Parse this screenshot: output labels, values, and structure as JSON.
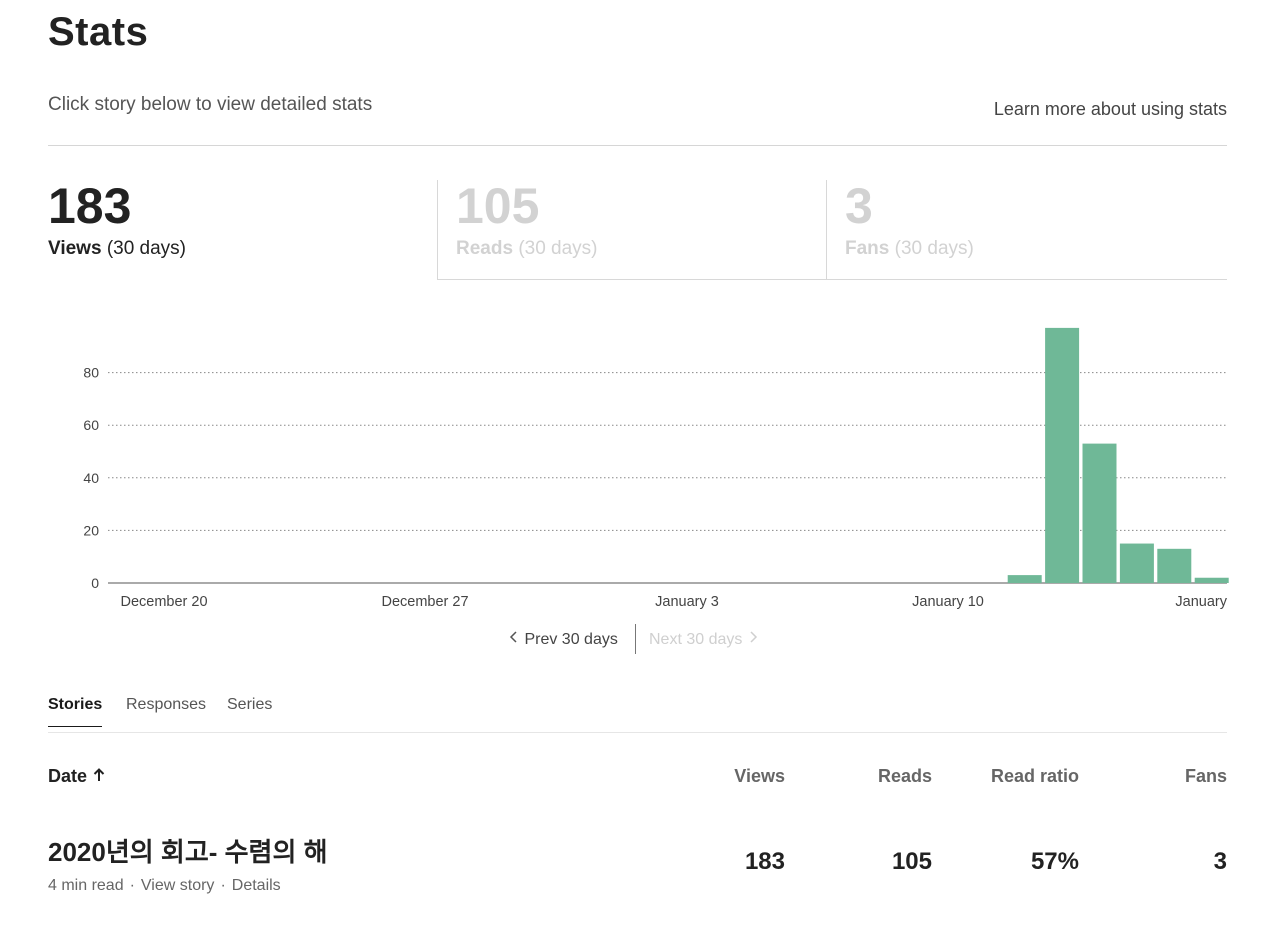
{
  "header": {
    "title": "Stats",
    "subtitle": "Click story below to view detailed stats",
    "learn_more": "Learn more about using stats"
  },
  "metrics": [
    {
      "value": "183",
      "label": "Views",
      "period": "(30 days)",
      "active": true
    },
    {
      "value": "105",
      "label": "Reads",
      "period": "(30 days)",
      "active": false
    },
    {
      "value": "3",
      "label": "Fans",
      "period": "(30 days)",
      "active": false
    }
  ],
  "chart_data": {
    "type": "bar",
    "x_tick_labels": [
      "December 20",
      "December 27",
      "January 3",
      "January 10",
      "January"
    ],
    "ylim": [
      0,
      100
    ],
    "yticks": [
      0,
      20,
      40,
      60,
      80
    ],
    "values": [
      0,
      0,
      0,
      0,
      0,
      0,
      0,
      0,
      0,
      0,
      0,
      0,
      0,
      0,
      0,
      0,
      0,
      0,
      0,
      0,
      0,
      0,
      0,
      0,
      3,
      97,
      53,
      15,
      13,
      2
    ],
    "bar_color": "#6fb897",
    "grid": true
  },
  "pager": {
    "prev": "Prev 30 days",
    "next": "Next 30 days"
  },
  "tabs": [
    "Stories",
    "Responses",
    "Series"
  ],
  "table": {
    "headers": {
      "date": "Date",
      "views": "Views",
      "reads": "Reads",
      "ratio": "Read ratio",
      "fans": "Fans"
    },
    "rows": [
      {
        "title": "2020년의 회고- 수렴의 해",
        "read_time": "4 min read",
        "view_story": "View story",
        "details": "Details",
        "views": "183",
        "reads": "105",
        "ratio": "57%",
        "fans": "3"
      }
    ]
  }
}
